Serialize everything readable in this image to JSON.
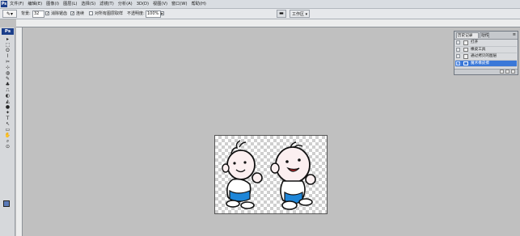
{
  "app": {
    "logo": "Ps",
    "menus": [
      "文件(F)",
      "编辑(E)",
      "图像(I)",
      "图层(L)",
      "选择(S)",
      "滤镜(T)",
      "分析(A)",
      "3D(D)",
      "视图(V)",
      "窗口(W)",
      "帮助(H)"
    ]
  },
  "options": {
    "tool_icon": "brush-icon",
    "size_label": "背景:",
    "size_value": "32",
    "cb1_label": "消除锯齿",
    "cb2_label": "连续",
    "cb3_label": "对所有图层取样",
    "opacity_label": "不透明度:",
    "opacity_value": "100%",
    "workspace_label": "工作区 ▾"
  },
  "toolbox": {
    "logo": "Ps",
    "tools": [
      "▸",
      "⬚",
      "ʘ",
      "⌇",
      "✂",
      "⊹",
      "◍",
      "✎",
      "♣",
      "⎍",
      "◐",
      "◭",
      "●",
      "✦",
      "T",
      "↖",
      "▭",
      "✋",
      "⌕",
      "⊙"
    ],
    "fg_color": "#5a7ab8"
  },
  "history": {
    "tab_history": "历史记录",
    "tab_actions": "动作",
    "menu_icon": "≡",
    "items": [
      {
        "label": "打开",
        "icon": "open-icon"
      },
      {
        "label": "橡皮工具",
        "icon": "eraser-icon"
      },
      {
        "label": "通过拷贝的图层",
        "icon": "layer-copy-icon"
      },
      {
        "label": "魔术橡皮擦",
        "icon": "magic-eraser-icon"
      }
    ],
    "selected_index": 3,
    "selection_color": "#3a78d8"
  },
  "canvas": {
    "background": "transparency-checkerboard"
  }
}
